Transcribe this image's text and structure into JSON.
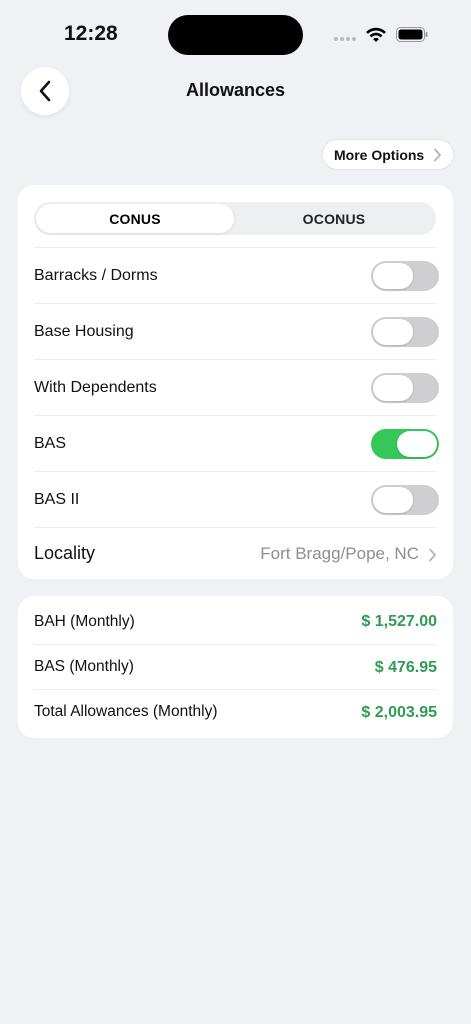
{
  "status": {
    "time": "12:28"
  },
  "header": {
    "title": "Allowances"
  },
  "toolbar": {
    "more_options_label": "More Options"
  },
  "segments": [
    {
      "label": "CONUS",
      "selected": true
    },
    {
      "label": "OCONUS",
      "selected": false
    }
  ],
  "options": [
    {
      "label": "Barracks / Dorms",
      "on": false
    },
    {
      "label": "Base Housing",
      "on": false
    },
    {
      "label": "With Dependents",
      "on": false
    },
    {
      "label": "BAS",
      "on": true
    },
    {
      "label": "BAS II",
      "on": false
    }
  ],
  "locality": {
    "label": "Locality",
    "value": "Fort Bragg/Pope, NC"
  },
  "summary": [
    {
      "label": "BAH (Monthly)",
      "value": "$ 1,527.00"
    },
    {
      "label": "BAS (Monthly)",
      "value": "$ 476.95"
    },
    {
      "label": "Total Allowances (Monthly)",
      "value": "$ 2,003.95"
    }
  ],
  "colors": {
    "accent_green": "#36c759",
    "amount_green": "#2e9d52",
    "background": "#f0f1f5"
  },
  "icons": {
    "back": "chevron-left-icon",
    "more": "chevron-right-icon",
    "wifi": "wifi-icon",
    "battery": "battery-icon"
  }
}
